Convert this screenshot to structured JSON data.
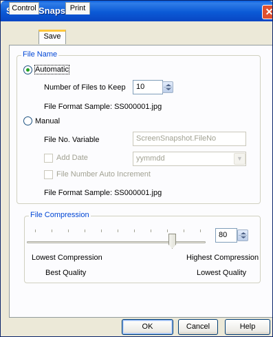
{
  "window": {
    "title": "Screen Snapshot",
    "close_glyph": "✕"
  },
  "tabs": [
    {
      "label": "Control",
      "active": false
    },
    {
      "label": "Save",
      "active": true
    },
    {
      "label": "Print",
      "active": false
    }
  ],
  "file_name_group": {
    "label": "File Name",
    "automatic": {
      "label": "Automatic",
      "selected": true,
      "num_files_label": "Number of Files to Keep",
      "num_files_value": "10",
      "format_sample": "File Format Sample: SS000001.jpg"
    },
    "manual": {
      "label": "Manual",
      "selected": false,
      "file_no_variable_label": "File No. Variable",
      "file_no_variable_value": "ScreenSnapshot.FileNo",
      "add_date_label": "Add Date",
      "add_date_checked": false,
      "date_format_value": "yymmdd",
      "auto_increment_label": "File Number Auto Increment",
      "auto_increment_checked": false,
      "format_sample": "File Format Sample: SS000001.jpg"
    }
  },
  "compression_group": {
    "label": "File Compression",
    "value": "80",
    "slider_percent": 80,
    "tick_count": 11,
    "low_label": "Lowest Compression",
    "low_sublabel": "Best Quality",
    "high_label": "Highest Compression",
    "high_sublabel": "Lowest Quality"
  },
  "buttons": {
    "ok": "OK",
    "cancel": "Cancel",
    "help": "Help"
  },
  "icons": {
    "spin": "spin-up-down-icon",
    "dropdown": "chevron-down-icon",
    "close": "close-icon"
  },
  "colors": {
    "titlebar": "#0b5ad6",
    "group_label": "#0046d5",
    "tab_highlight": "#ffc83c",
    "radio_dot": "#21a121",
    "close_button": "#e0512f"
  }
}
